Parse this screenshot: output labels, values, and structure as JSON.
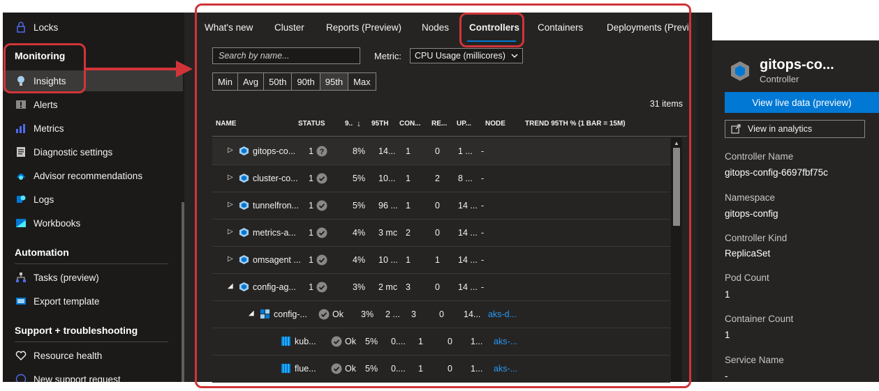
{
  "sidebar": {
    "items_top": [
      {
        "label": "Locks",
        "icon": "lock-icon"
      },
      {
        "label": "Insights",
        "icon": "lightbulb-icon"
      },
      {
        "label": "Alerts",
        "icon": "alert-icon"
      },
      {
        "label": "Metrics",
        "icon": "metrics-icon"
      },
      {
        "label": "Diagnostic settings",
        "icon": "diagnostic-icon"
      },
      {
        "label": "Advisor recommendations",
        "icon": "advisor-icon"
      },
      {
        "label": "Logs",
        "icon": "logs-icon"
      },
      {
        "label": "Workbooks",
        "icon": "workbooks-icon"
      }
    ],
    "section_monitoring": "Monitoring",
    "section_automation": "Automation",
    "automation_items": [
      {
        "label": "Tasks (preview)",
        "icon": "tasks-icon"
      },
      {
        "label": "Export template",
        "icon": "export-icon"
      }
    ],
    "section_support": "Support + troubleshooting",
    "support_items": [
      {
        "label": "Resource health",
        "icon": "heart-icon"
      },
      {
        "label": "New support request",
        "icon": "support-icon"
      }
    ]
  },
  "tabs": [
    "What's new",
    "Cluster",
    "Reports (Preview)",
    "Nodes",
    "Controllers",
    "Containers",
    "Deployments (Preview)"
  ],
  "active_tab": "Controllers",
  "search": {
    "placeholder": "Search by name..."
  },
  "metric": {
    "label": "Metric:",
    "value": "CPU Usage (millicores)"
  },
  "percentiles": [
    "Min",
    "Avg",
    "50th",
    "90th",
    "95th",
    "Max"
  ],
  "active_percentile": "95th",
  "items_count": "31 items",
  "columns": {
    "name": "NAME",
    "status": "STATUS",
    "pct": "9..",
    "sort": "↓",
    "p95": "95TH",
    "containers": "CON...",
    "restarts": "RE...",
    "uptime": "UP...",
    "node": "NODE",
    "trend": "TREND 95TH % (1 BAR = 15M)"
  },
  "rows": [
    {
      "name": "gitops-co...",
      "status_count": "1",
      "status_icon": "unknown",
      "pct": "8%",
      "p95": "14...",
      "con": "1",
      "re": "0",
      "up": "1 ...",
      "node": "-",
      "level": 0,
      "caret": "▷",
      "type": "controller"
    },
    {
      "name": "cluster-co...",
      "status_count": "1",
      "status_icon": "ok",
      "pct": "5%",
      "p95": "10...",
      "con": "1",
      "re": "2",
      "up": "8 ...",
      "node": "-",
      "level": 0,
      "caret": "▷",
      "type": "controller"
    },
    {
      "name": "tunnelfron...",
      "status_count": "1",
      "status_icon": "ok",
      "pct": "5%",
      "p95": "96 ...",
      "con": "1",
      "re": "0",
      "up": "14 ...",
      "node": "-",
      "level": 0,
      "caret": "▷",
      "type": "controller"
    },
    {
      "name": "metrics-a...",
      "status_count": "1",
      "status_icon": "ok",
      "pct": "4%",
      "p95": "3 mc",
      "con": "2",
      "re": "0",
      "up": "14 ...",
      "node": "-",
      "level": 0,
      "caret": "▷",
      "type": "controller"
    },
    {
      "name": "omsagent ...",
      "status_count": "1",
      "status_icon": "ok",
      "pct": "4%",
      "p95": "10 ...",
      "con": "1",
      "re": "1",
      "up": "14 ...",
      "node": "-",
      "level": 0,
      "caret": "▷",
      "type": "controller"
    },
    {
      "name": "config-ag...",
      "status_count": "1",
      "status_icon": "ok",
      "pct": "3%",
      "p95": "2 mc",
      "con": "3",
      "re": "0",
      "up": "14 ...",
      "node": "-",
      "level": 0,
      "caret": "◢",
      "type": "controller"
    },
    {
      "name": "config-...",
      "status_count": "Ok",
      "status_icon": "ok",
      "pct": "3%",
      "p95": "2 ...",
      "con": "3",
      "re": "0",
      "up": "14...",
      "node": "aks-d...",
      "level": 1,
      "caret": "◢",
      "type": "pod"
    },
    {
      "name": "kub...",
      "status_count": "Ok",
      "status_icon": "ok",
      "pct": "5%",
      "p95": "0....",
      "con": "1",
      "re": "0",
      "up": "1...",
      "node": "aks-...",
      "level": 2,
      "caret": "",
      "type": "container"
    },
    {
      "name": "flue...",
      "status_count": "Ok",
      "status_icon": "ok",
      "pct": "5%",
      "p95": "0....",
      "con": "1",
      "re": "0",
      "up": "1...",
      "node": "aks-...",
      "level": 2,
      "caret": "",
      "type": "container"
    }
  ],
  "panel": {
    "collapse": "»",
    "title": "gitops-co...",
    "subtitle": "Controller",
    "live_button": "View live data (preview)",
    "analytics_button": "View in analytics",
    "fields": [
      {
        "label": "Controller Name",
        "value": "gitops-config-6697fbf75c"
      },
      {
        "label": "Namespace",
        "value": "gitops-config"
      },
      {
        "label": "Controller Kind",
        "value": "ReplicaSet"
      },
      {
        "label": "Pod Count",
        "value": "1"
      },
      {
        "label": "Container Count",
        "value": "1"
      },
      {
        "label": "Service Name",
        "value": "-"
      }
    ]
  },
  "colors": {
    "accent": "#0078d4",
    "annotation": "#d13438",
    "ok": "#8a8886"
  }
}
